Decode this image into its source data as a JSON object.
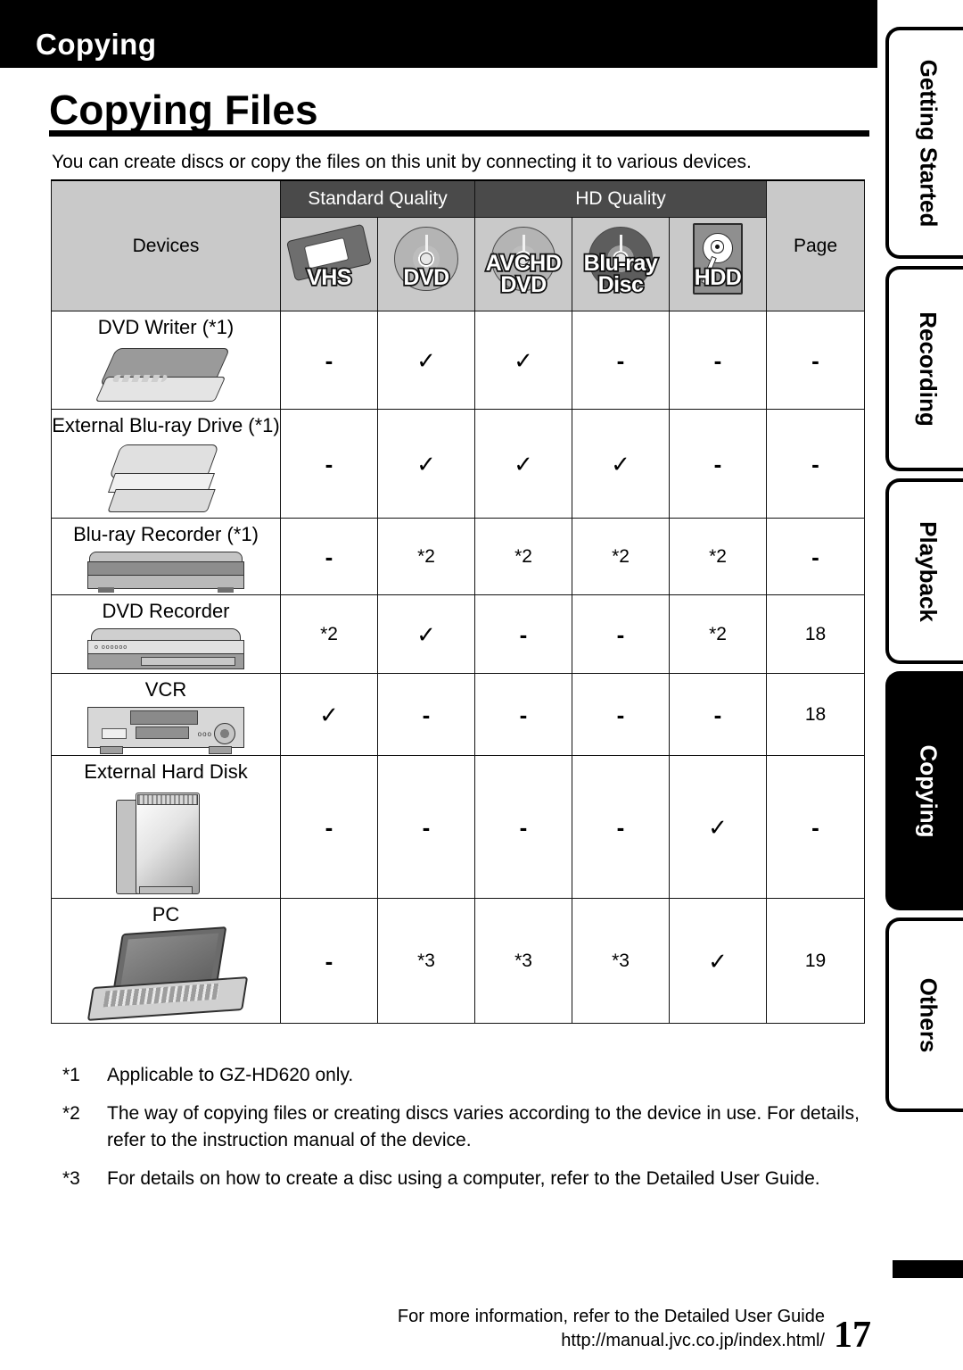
{
  "header": {
    "section_label": "Copying"
  },
  "page": {
    "title": "Copying Files",
    "intro": "You can create discs or copy the files on this unit by connecting it to various devices."
  },
  "table": {
    "group_headers": {
      "devices": "Devices",
      "standard_quality": "Standard Quality",
      "hd_quality": "HD Quality",
      "page": "Page"
    },
    "media_columns": [
      {
        "id": "vhs",
        "label": "VHS",
        "icon": "vhs-cassette-icon"
      },
      {
        "id": "dvd",
        "label": "DVD",
        "icon": "dvd-disc-icon"
      },
      {
        "id": "avchd_dvd",
        "label": "AVCHD\nDVD",
        "icon": "avchd-dvd-disc-icon"
      },
      {
        "id": "bluray_disc",
        "label": "Blu-ray\nDisc",
        "icon": "bluray-disc-icon"
      },
      {
        "id": "hdd",
        "label": "HDD",
        "icon": "hdd-drive-icon"
      }
    ],
    "rows": [
      {
        "device": "DVD Writer (*1)",
        "icon": "dvd-writer-icon",
        "cells": [
          "-",
          "✓",
          "✓",
          "-",
          "-"
        ],
        "page": "-"
      },
      {
        "device": "External Blu-ray Drive (*1)",
        "icon": "external-bluray-drive-icon",
        "cells": [
          "-",
          "✓",
          "✓",
          "✓",
          "-"
        ],
        "page": "-"
      },
      {
        "device": "Blu-ray Recorder (*1)",
        "icon": "bluray-recorder-icon",
        "cells": [
          "-",
          "*2",
          "*2",
          "*2",
          "*2"
        ],
        "page": "-"
      },
      {
        "device": "DVD Recorder",
        "icon": "dvd-recorder-icon",
        "cells": [
          "*2",
          "✓",
          "-",
          "-",
          "*2"
        ],
        "page": "18"
      },
      {
        "device": "VCR",
        "icon": "vcr-icon",
        "cells": [
          "✓",
          "-",
          "-",
          "-",
          "-"
        ],
        "page": "18"
      },
      {
        "device": "External Hard Disk",
        "icon": "external-hard-disk-icon",
        "cells": [
          "-",
          "-",
          "-",
          "-",
          "✓"
        ],
        "page": "-"
      },
      {
        "device": "PC",
        "icon": "pc-laptop-icon",
        "cells": [
          "-",
          "*3",
          "*3",
          "*3",
          "✓"
        ],
        "page": "19"
      }
    ]
  },
  "footnotes": [
    {
      "marker": "*1",
      "text": "Applicable to GZ-HD620 only."
    },
    {
      "marker": "*2",
      "text": "The way of copying files or creating discs varies according to the device in use. For details, refer to the instruction manual of the device."
    },
    {
      "marker": "*3",
      "text": "For details on how to create a disc using a computer, refer to the Detailed User Guide."
    }
  ],
  "footer": {
    "line1": "For more information, refer to the Detailed User Guide",
    "line2": "http://manual.jvc.co.jp/index.html/",
    "page_number": "17"
  },
  "side_tabs": [
    {
      "label": "Getting Started",
      "active": false
    },
    {
      "label": "Recording",
      "active": false
    },
    {
      "label": "Playback",
      "active": false
    },
    {
      "label": "Copying",
      "active": true
    },
    {
      "label": "Others",
      "active": false
    }
  ],
  "colors": {
    "header_band": "#000000",
    "group_header_dark": "#4a4a4a",
    "group_header_light": "#c9c9c9",
    "text": "#000000"
  }
}
